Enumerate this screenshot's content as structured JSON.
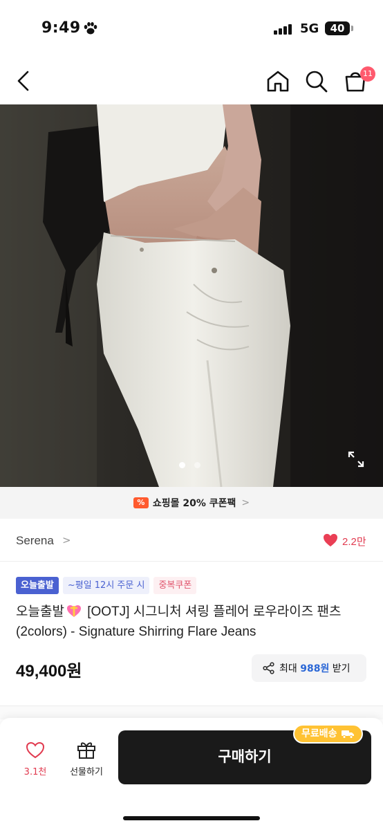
{
  "status_bar": {
    "time": "9:49",
    "network": "5G",
    "battery": "40"
  },
  "nav": {
    "cart_count": "11",
    "icons": [
      "back-icon",
      "home-icon",
      "search-icon",
      "cart-icon"
    ]
  },
  "gallery": {
    "current": 1,
    "total": 2
  },
  "coupon_strip": {
    "icon_text": "%",
    "text": "쇼핑몰 20% 쿠폰팩",
    "chevron": ">"
  },
  "brand": {
    "name": "Serena",
    "chevron": ">",
    "likes": "2.2만"
  },
  "badges": {
    "today_ship": "오늘출발",
    "weekday_cutoff": "~평일 12시 주문 시",
    "coupon": "중복쿠폰"
  },
  "product": {
    "title_prefix": "오늘출발",
    "title_rest": " [OOTJ] 시그니처 셔링 플레어 로우라이즈 팬츠 (2colors) - Signature Shirring Flare Jeans",
    "price": "49,400원"
  },
  "share": {
    "prefix": "최대 ",
    "amount": "988원",
    "suffix": " 받기"
  },
  "bottom_bar": {
    "wish_count": "3.1천",
    "gift_label": "선물하기",
    "buy_label": "구매하기",
    "free_shipping": "무료배송"
  },
  "colors": {
    "accent_blue": "#4a61d1",
    "like_red": "#e13a4f",
    "buy_black": "#1a1a1a",
    "free_ship_yellow": "#ffc233",
    "coupon_orange": "#ff5a2e"
  }
}
